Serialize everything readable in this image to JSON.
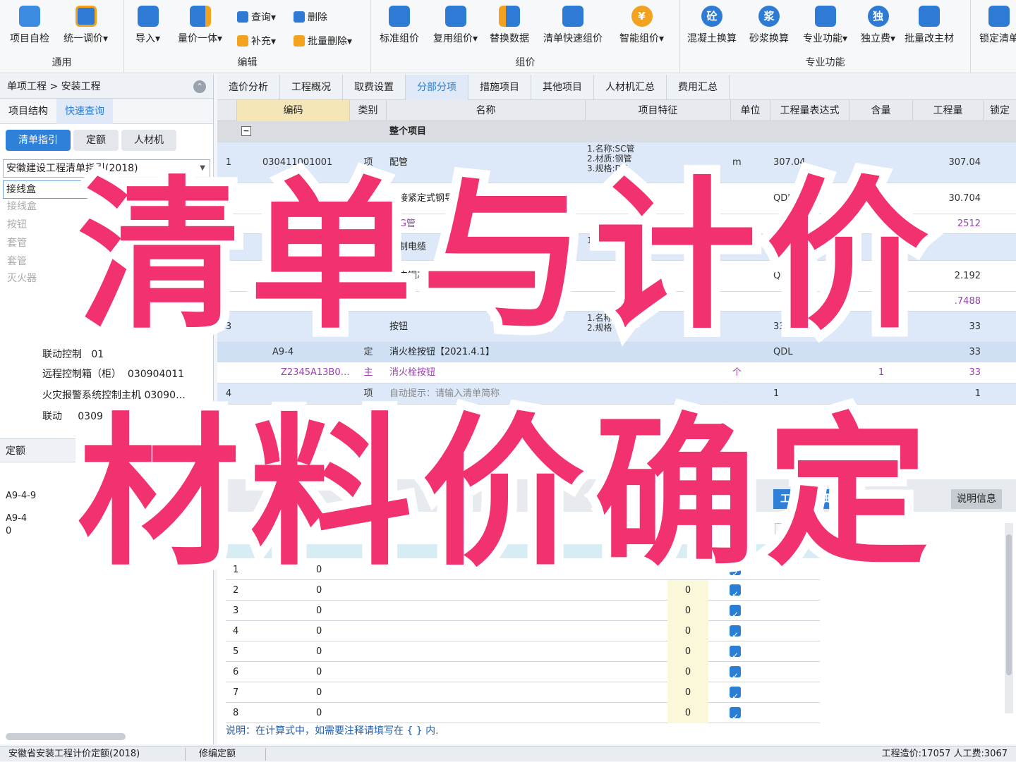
{
  "ribbon": {
    "groups": [
      {
        "label": "通用",
        "buttons": [
          "项目自检",
          "统一调价▾"
        ]
      },
      {
        "label": "编辑",
        "buttons": [
          "导入▾",
          "量价一体▾"
        ],
        "small": [
          "查询▾",
          "删除",
          "补充▾",
          "批量删除▾"
        ]
      },
      {
        "label": "组价",
        "buttons": [
          "标准组价",
          "复用组价▾",
          "替换数据",
          "清单快速组价",
          "智能组价▾"
        ]
      },
      {
        "label": "专业功能",
        "buttons": [
          "混凝土换算",
          "砂浆换算",
          "专业功能▾",
          "独立费▾",
          "批量改主材"
        ],
        "icon_text": [
          "砼",
          "浆",
          "",
          "独",
          ""
        ]
      },
      {
        "label": "",
        "buttons": [
          "锁定清单"
        ]
      }
    ]
  },
  "left": {
    "crumb": "单项工程 > 安装工程",
    "subtabs": [
      "项目结构",
      "快速查询"
    ],
    "pills": [
      "清单指引",
      "定额",
      "人材机"
    ],
    "guide_combo": "安徽建设工程清单指引(2018)",
    "search_value": "接线盒",
    "dropdown": [
      "接线盒",
      "按钮",
      "套管",
      "套管",
      "灭火器"
    ],
    "tree": [
      {
        "name": "联动控制",
        "code": "01"
      },
      {
        "name": "远程控制箱（柜）",
        "code": "030904011"
      },
      {
        "name": "火灾报警系统控制主机",
        "code": "03090…"
      },
      {
        "name": "联动",
        "code": "0309040"
      }
    ],
    "bottom_label": "定额",
    "bottom_rows": [
      "A9-4-9",
      "A9-4",
      "0"
    ]
  },
  "main": {
    "tabs": [
      "造价分析",
      "工程概况",
      "取费设置",
      "分部分项",
      "措施项目",
      "其他项目",
      "人材机汇总",
      "费用汇总"
    ],
    "active_tab": "分部分项",
    "headers": [
      "编码",
      "类别",
      "名称",
      "项目特征",
      "单位",
      "工程量表达式",
      "含量",
      "工程量",
      "锁定"
    ],
    "whole_project": "整个项目",
    "rows": [
      {
        "no": "1",
        "code": "030411001001",
        "type": "项",
        "name": "配管",
        "feature": "1.名称:SC管\n2.材质:钢管\n3.规格:DN",
        "unit": "m",
        "expr": "307.04",
        "qty": "307.04"
      },
      {
        "no": "",
        "code": "",
        "type": "",
        "name": "套接紧定式钢导管敷设 砖、混凝土结构明配",
        "feature": "",
        "unit": "",
        "expr": "QDL",
        "qty": "30.704"
      },
      {
        "no": "",
        "code": "",
        "type": "",
        "name": "JDG管",
        "feature": "",
        "unit": "",
        "expr": "",
        "qty": "2512"
      },
      {
        "no": "2",
        "code": "",
        "type": "",
        "name": "控制电缆",
        "feature": "1.名称",
        "unit": "",
        "expr": "",
        "qty": ""
      },
      {
        "no": "",
        "code": "",
        "type": "",
        "name": "室内铜芯",
        "feature": "",
        "unit": "",
        "expr": "QDL",
        "qty": "2.192"
      },
      {
        "no": "",
        "code": "",
        "type": "",
        "name": "",
        "feature": "",
        "unit": "",
        "expr": "",
        "qty": ".7488"
      },
      {
        "no": "3",
        "code": "",
        "type": "",
        "name": "按钮",
        "feature": "1.名称\n2.规格",
        "unit": "",
        "expr": "33",
        "qty": "33"
      },
      {
        "no": "",
        "code": "A9-4",
        "type": "定",
        "name": "消火栓按钮【2021.4.1】",
        "feature": "",
        "unit": "",
        "expr": "QDL",
        "qty": "33"
      },
      {
        "no": "",
        "code": "Z2345A13B0…",
        "type": "主",
        "name": "消火栓按钮",
        "feature": "",
        "unit": "个",
        "expr": "",
        "hl": "1",
        "qty": "33"
      },
      {
        "no": "4",
        "code": "",
        "type": "项",
        "name": "自动提示：请输入清单简称",
        "feature": "",
        "unit": "",
        "expr": "1",
        "qty": "1"
      }
    ]
  },
  "lower": {
    "tab_right1": "工程量明细",
    "tab_right2": "说明信息",
    "code_label": "代码",
    "rows": [
      {
        "n": "1",
        "v": "0",
        "r": ""
      },
      {
        "n": "2",
        "v": "0",
        "r": "0"
      },
      {
        "n": "3",
        "v": "0",
        "r": "0"
      },
      {
        "n": "4",
        "v": "0",
        "r": "0"
      },
      {
        "n": "5",
        "v": "0",
        "r": "0"
      },
      {
        "n": "6",
        "v": "0",
        "r": "0"
      },
      {
        "n": "7",
        "v": "0",
        "r": "0"
      },
      {
        "n": "8",
        "v": "0",
        "r": "0"
      }
    ],
    "note": "说明：在计算式中，如需要注释请填写在 { } 内."
  },
  "status": {
    "left": "安徽省安装工程计价定额(2018)",
    "mid": "修编定额",
    "right": "工程造价:17057   人工费:3067"
  },
  "overlay": {
    "line1": "清单与计价",
    "line2": "材料价确定",
    "color": "#f2326f"
  }
}
